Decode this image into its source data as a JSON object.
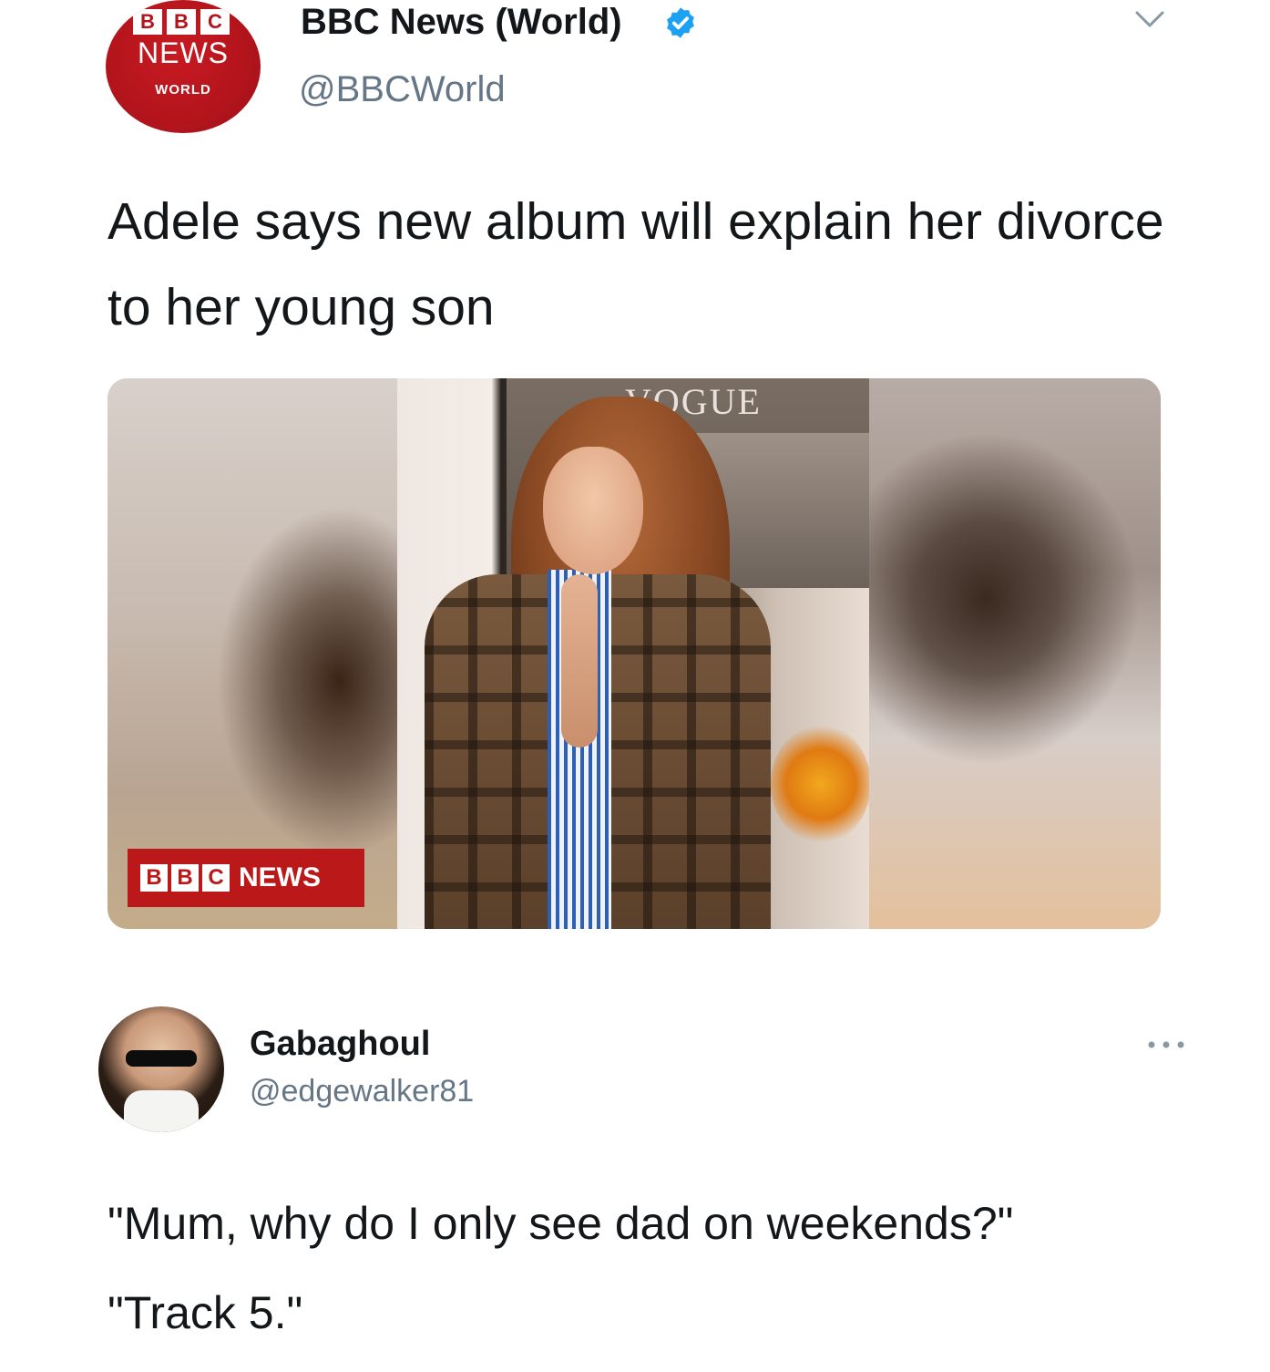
{
  "tweet": {
    "avatar": {
      "blocks": [
        "B",
        "B",
        "C"
      ],
      "news": "NEWS",
      "world": "WORLD"
    },
    "display_name": "BBC News (World)",
    "handle": "@BBCWorld",
    "text": "Adele says new album will explain her divorce to her young son",
    "media": {
      "magazine_text": "VOGUE",
      "badge_blocks": [
        "B",
        "B",
        "C"
      ],
      "badge_label": "NEWS"
    }
  },
  "reply": {
    "display_name": "Gabaghoul",
    "handle": "@edgewalker81",
    "line1": "\"Mum, why do I only see dad on weekends?\"",
    "line2": "\"Track 5.\""
  },
  "colors": {
    "bbc_red": "#bb1919",
    "verified_blue": "#1da1f2",
    "handle_gray": "#657786"
  },
  "icons": [
    "verified-badge-icon",
    "chevron-down-icon",
    "more-options-icon"
  ]
}
